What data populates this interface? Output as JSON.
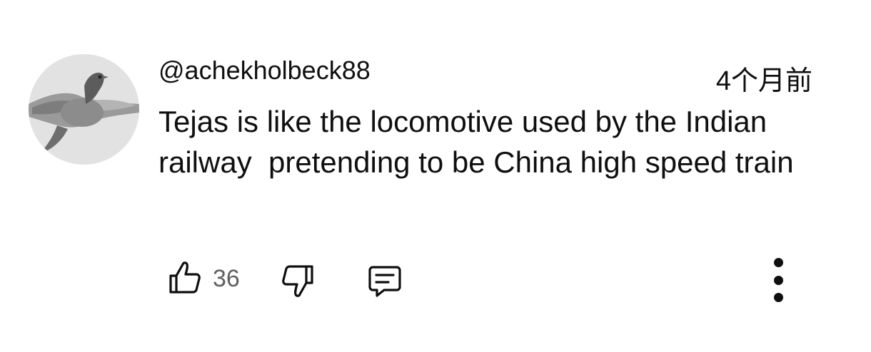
{
  "comment": {
    "handle": "@achekholbeck88",
    "timestamp": "4个月前",
    "text": "Tejas is like the locomotive used by the Indian railway  pretending to be China high speed train",
    "avatar_icon": "pigeon-avatar",
    "actions": {
      "like_icon": "thumbs-up-icon",
      "like_count": "36",
      "dislike_icon": "thumbs-down-icon",
      "reply_icon": "reply-comment-icon",
      "more_icon": "more-vertical-icon"
    }
  }
}
